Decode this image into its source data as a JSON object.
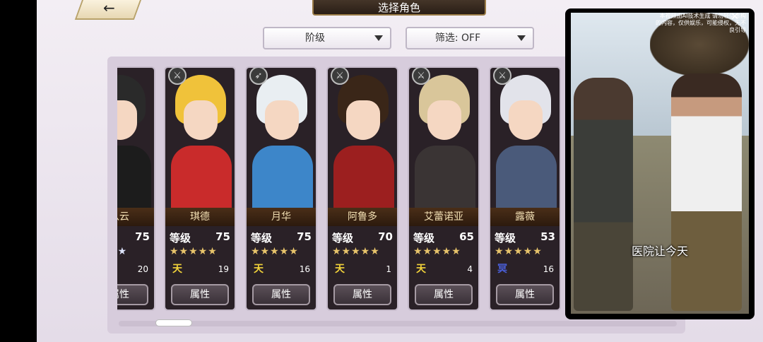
{
  "header": {
    "back_icon": "←",
    "title": "选择角色"
  },
  "filters": {
    "rank_label": "阶级",
    "filter_label": "筛选: OFF"
  },
  "cards": [
    {
      "name": "八云",
      "level_label": "级",
      "level": "75",
      "stars": "★★★★",
      "rank": "",
      "count": "20",
      "button": "属性",
      "hair": "#2a2a2a",
      "body": "#1c1c1c"
    },
    {
      "name": "琪德",
      "level_label": "等级",
      "level": "75",
      "stars": "★★★★★",
      "rank": "天",
      "count": "19",
      "button": "属性",
      "hair": "#f0c23a",
      "body": "#c92b2b"
    },
    {
      "name": "月华",
      "level_label": "等级",
      "level": "75",
      "stars": "★★★★★",
      "rank": "天",
      "count": "16",
      "button": "属性",
      "hair": "#e9eef2",
      "body": "#3d86c9"
    },
    {
      "name": "阿鲁多",
      "level_label": "等级",
      "level": "70",
      "stars": "★★★★★",
      "rank": "天",
      "count": "1",
      "button": "属性",
      "hair": "#3a2618",
      "body": "#9c1f1f"
    },
    {
      "name": "艾蕾诺亚",
      "level_label": "等级",
      "level": "65",
      "stars": "★★★★★",
      "rank": "天",
      "count": "4",
      "button": "属性",
      "hair": "#d9c69a",
      "body": "#3a3434"
    },
    {
      "name": "露薇",
      "level_label": "等级",
      "level": "53",
      "stars": "★★★★★",
      "rank": "冥",
      "count": "16",
      "button": "属性",
      "hair": "#e2e3ea",
      "body": "#4a5a7a"
    }
  ],
  "video": {
    "notice": "本视频由AI技术生成 请勿轻信虚构的内容，仅供娱乐，可能侵权，无不良引导",
    "close_icon": "✕",
    "caption": "医院让今天"
  },
  "colors": {
    "rank_tian": "#f2d33a",
    "rank_ming": "#4a5fd9"
  }
}
